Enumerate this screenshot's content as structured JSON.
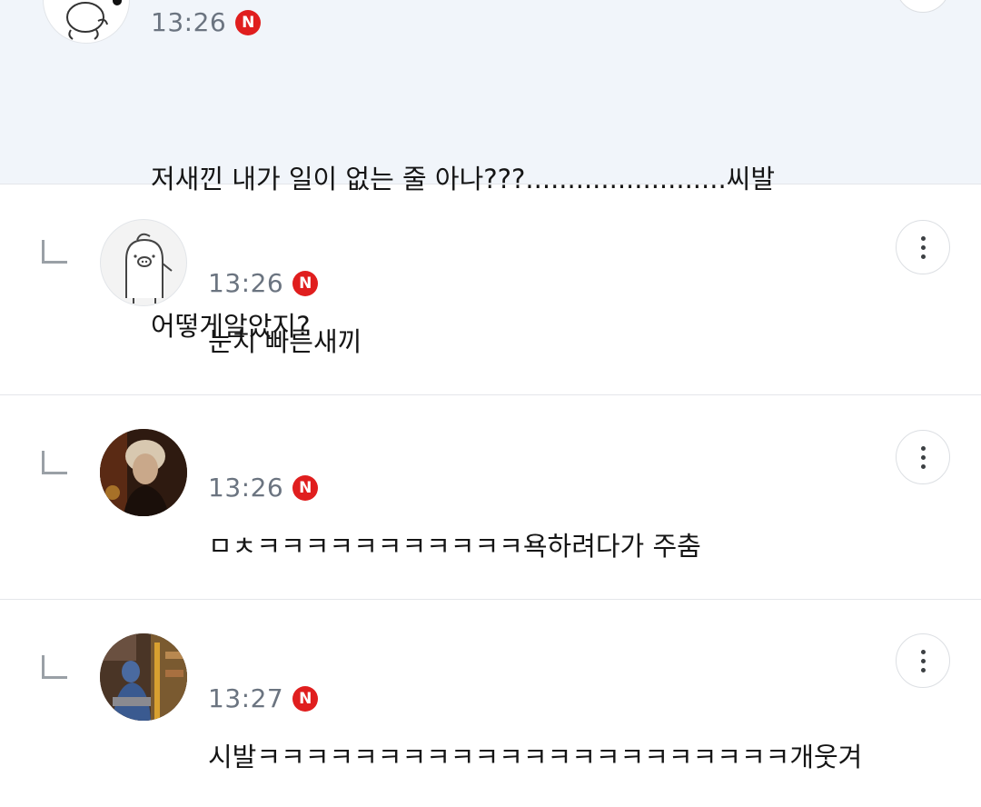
{
  "comments": [
    {
      "time": "13:26",
      "badge": "N",
      "line1": "저새낀 내가 일이 없는 줄 아나???........................씨발",
      "line2": "어떻게알았지?"
    },
    {
      "time": "13:26",
      "badge": "N",
      "text": "눈치 빠른새끼"
    },
    {
      "time": "13:26",
      "badge": "N",
      "text": "ㅁㅊㅋㅋㅋㅋㅋㅋㅋㅋㅋㅋㅋ욕하려다가 주춤"
    },
    {
      "time": "13:27",
      "badge": "N",
      "text": "시발ㅋㅋㅋㅋㅋㅋㅋㅋㅋㅋㅋㅋㅋㅋㅋㅋㅋㅋㅋㅋㅋㅋ개웃겨"
    }
  ],
  "colors": {
    "highlight_bg": "#f1f5fa",
    "badge_red": "#e01e1e",
    "time_gray": "#6b7480"
  },
  "icons": [
    "reply-arrow-icon",
    "more-options-icon",
    "naver-badge-icon"
  ]
}
